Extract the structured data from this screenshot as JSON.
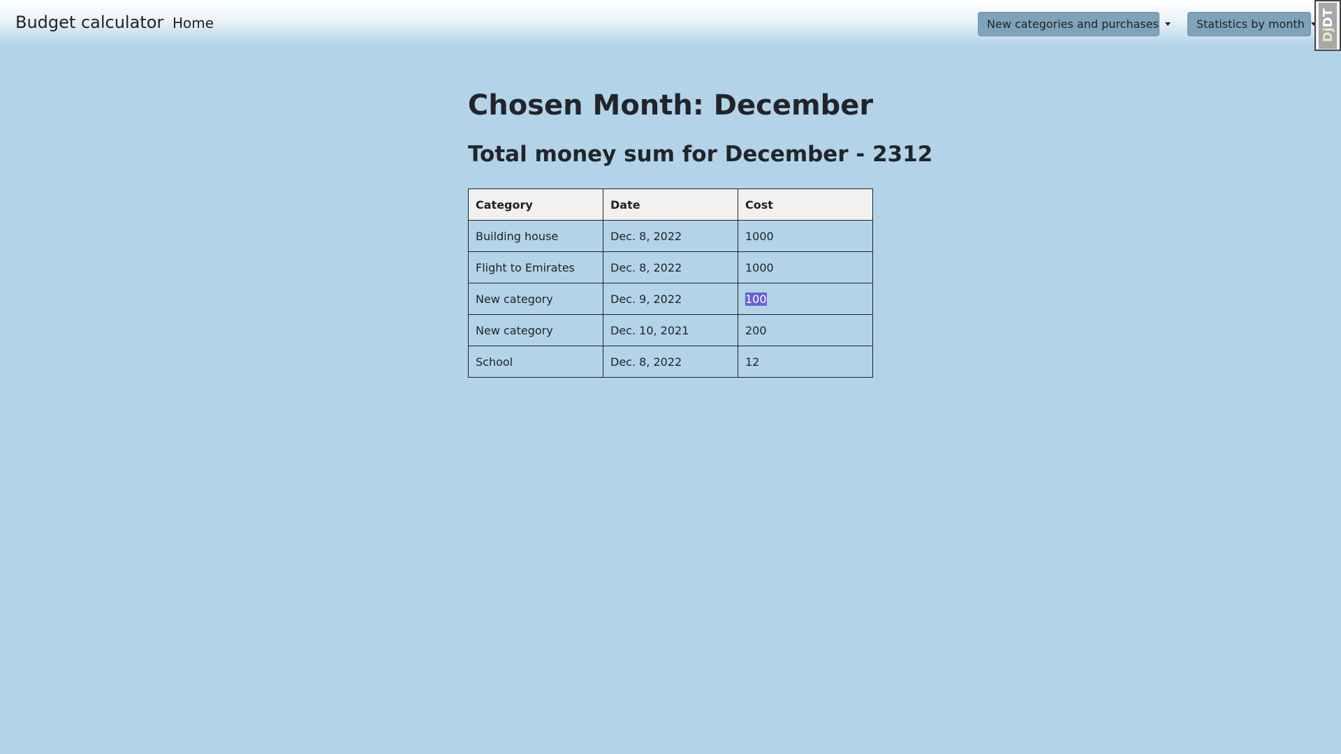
{
  "navbar": {
    "brand": "Budget calculator",
    "home": "Home",
    "dropdowns": [
      {
        "label": "New categories and purchases"
      },
      {
        "label": "Statistics by month"
      }
    ],
    "debug_toolbar": {
      "prefix": "Dj",
      "suffix": "DT"
    }
  },
  "main": {
    "title": "Chosen Month: December",
    "total": "Total money sum for December - 2312",
    "table": {
      "headers": [
        "Category",
        "Date",
        "Cost"
      ],
      "rows": [
        [
          "Building house",
          "Dec. 8, 2022",
          "1000"
        ],
        [
          "Flight to Emirates",
          "Dec. 8, 2022",
          "1000"
        ],
        [
          "New category",
          "Dec. 9, 2022",
          "100"
        ],
        [
          "New category",
          "Dec. 10, 2021",
          "200"
        ],
        [
          "School",
          "Dec. 8, 2022",
          "12"
        ]
      ]
    }
  },
  "colors": {
    "background": "#b3d3e8",
    "button": "#7fa3b8",
    "header_cell": "#f1f1f1",
    "selection": "#6b5fd8"
  },
  "icons": [
    "caret-down-icon"
  ]
}
